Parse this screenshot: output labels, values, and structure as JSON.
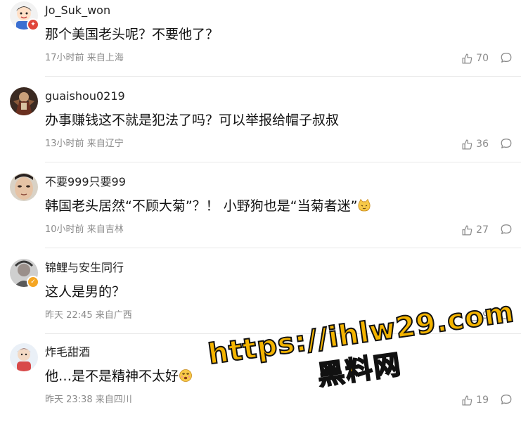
{
  "comments": [
    {
      "username": "Jo_Suk_won",
      "text": "那个美国老头呢？不要他了？",
      "time": "17小时前",
      "location": "来自上海",
      "likes": "70",
      "avatar": "avatar-cartoon-boy",
      "badge_color": "#e0453a"
    },
    {
      "username": "guaishou0219",
      "text": "办事赚钱这不就是犯法了吗？可以举报给帽子叔叔",
      "time": "13小时前",
      "location": "来自辽宁",
      "likes": "36",
      "avatar": "avatar-figure"
    },
    {
      "username": "不要999只要99",
      "text": "韩国老头居然“不顾大菊”？！ 小野狗也是“当菊者迷”",
      "time": "10小时前",
      "location": "来自吉林",
      "likes": "27",
      "avatar": "avatar-face",
      "emoji": "cat-emoji"
    },
    {
      "username": "锦鲤与安生同行",
      "text": "这人是男的？",
      "time": "昨天 22:45",
      "location": "来自广西",
      "likes": "9",
      "avatar": "avatar-photo",
      "badge_color": "#f5a623"
    },
    {
      "username": "炸毛甜酒",
      "text": "他…是不是精神不太好",
      "time": "昨天 23:38",
      "location": "来自四川",
      "likes": "19",
      "avatar": "avatar-cartoon",
      "emoji": "dizzy-face-emoji"
    }
  ],
  "watermark": {
    "url": "https://ihlw29.com",
    "site": "黑料网",
    "color": "#f4b400"
  },
  "colors": {
    "meta_text": "#8b8b8b",
    "divider": "#e8e8e8"
  }
}
